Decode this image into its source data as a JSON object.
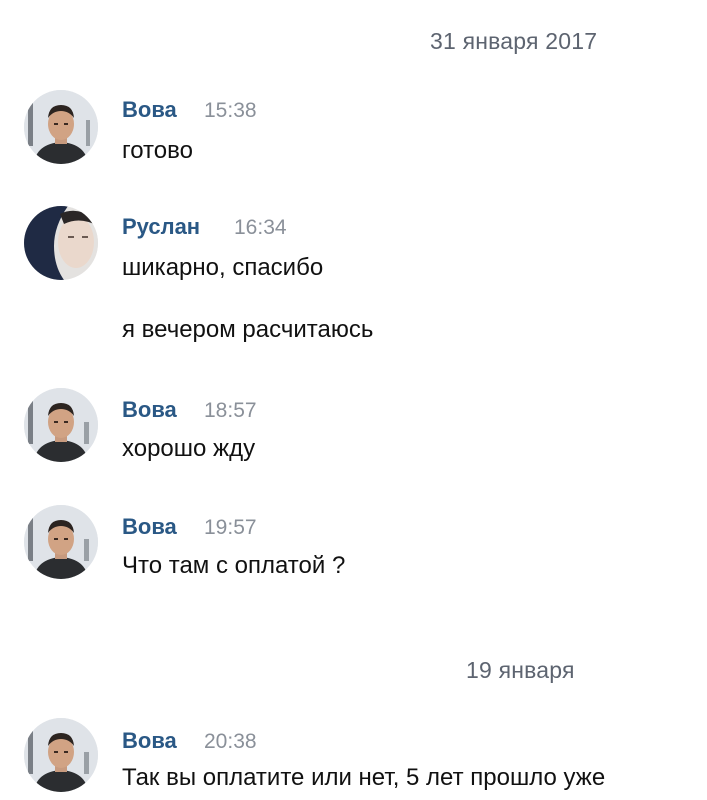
{
  "date_separators": [
    "31 января 2017",
    "19 января"
  ],
  "messages": [
    {
      "author": "Вова",
      "time": "15:38",
      "lines": [
        "готово"
      ],
      "avatar": "vova-avatar"
    },
    {
      "author": "Руслан",
      "time": "16:34",
      "lines": [
        "шикарно, спасибо",
        "я вечером расчитаюсь"
      ],
      "avatar": "ruslan-avatar"
    },
    {
      "author": "Вова",
      "time": "18:57",
      "lines": [
        "хорошо жду"
      ],
      "avatar": "vova-avatar"
    },
    {
      "author": "Вова",
      "time": "19:57",
      "lines": [
        "Что там с оплатой ?"
      ],
      "avatar": "vova-avatar"
    },
    {
      "author": "Вова",
      "time": "20:38",
      "lines": [
        "Так вы оплатите или нет, 5 лет прошло уже"
      ],
      "avatar": "vova-avatar"
    }
  ],
  "colors": {
    "author": "#2a5885",
    "time": "#8a9099",
    "date": "#5d6470",
    "text": "#111111",
    "background": "#ffffff"
  }
}
